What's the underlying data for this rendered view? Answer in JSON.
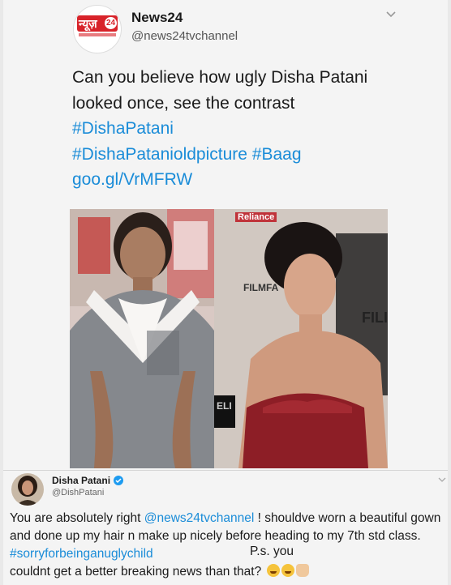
{
  "tweet": {
    "logo_text": "न्यूज़",
    "logo_number": "24",
    "account_name": "News24",
    "handle": "@news24tvchannel",
    "body_plain": "Can you believe how ugly Disha Patani looked once, see the contrast",
    "hashtag1": "#DishaPatani",
    "hashtag2": "#DishaPatanioldpicture",
    "hashtag3": "#Baag",
    "link": "goo.gl/VrMFRW",
    "image_right_text_1": "Reliance",
    "image_right_text_2": "FILMFA",
    "image_right_text_3": "FILI",
    "image_right_text_4": "ELI"
  },
  "reply": {
    "account_name": "Disha Patani",
    "handle": "@DishPatani",
    "text_a": "You are absolutely right",
    "mention": "@news24tvchannel",
    "text_b": "! shouldve worn a beautiful gown and done up my hair n make up nicely before heading to my 7th std class.",
    "hashtag": "#sorryforbeinganuglychild",
    "ps": "P.s. you",
    "text_c": "couldnt get a better breaking news than that?"
  },
  "colors": {
    "link_blue": "#1a8cd8",
    "news24_red": "#d8232a",
    "background": "#f4f4f4"
  },
  "icons": [
    "chevron-down-icon",
    "verified-icon",
    "laughing-emoji-icon",
    "thumbs-up-emoji-icon"
  ]
}
